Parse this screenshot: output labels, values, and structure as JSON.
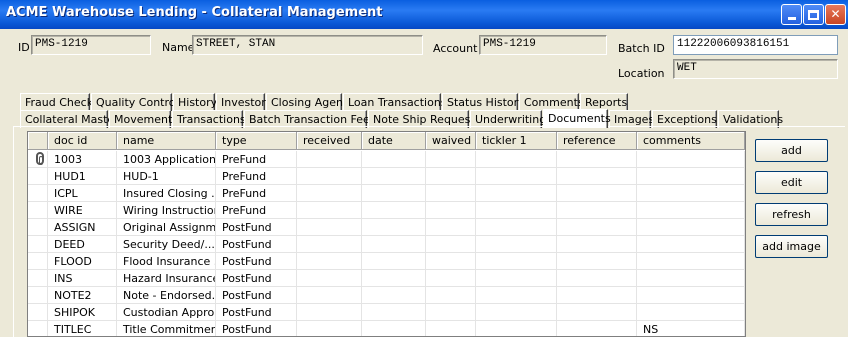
{
  "window": {
    "title": "ACME Warehouse Lending - Collateral Management"
  },
  "header": {
    "id_label": "ID",
    "id_value": "PMS-1219",
    "name_label": "Name",
    "name_value": "STREET, STAN",
    "account_label": "Account",
    "account_value": "PMS-1219",
    "batch_label": "Batch ID",
    "batch_value": "11222006093816151",
    "location_label": "Location",
    "location_value": "WET"
  },
  "tabs_row1": [
    "Fraud Check",
    "Quality Control",
    "History",
    "Investor",
    "Closing Agent",
    "Loan Transactions",
    "Status History",
    "Comments",
    "Reports"
  ],
  "tabs_row2": [
    "Collateral Master",
    "Movement",
    "Transactions",
    "Batch Transaction Fees",
    "Note Ship Request",
    "Underwriting",
    "Documents",
    "Images",
    "Exceptions",
    "Validations"
  ],
  "active_tab": "Documents",
  "grid": {
    "columns": [
      "doc id",
      "name",
      "type",
      "received",
      "date",
      "waived",
      "tickler 1",
      "reference",
      "comments"
    ],
    "rows": [
      {
        "doc_id": "1003",
        "name": "1003 Application",
        "type": "PreFund",
        "comments": "",
        "attached": true
      },
      {
        "doc_id": "HUD1",
        "name": "HUD-1",
        "type": "PreFund",
        "comments": ""
      },
      {
        "doc_id": "ICPL",
        "name": "Insured Closing ...",
        "type": "PreFund",
        "comments": ""
      },
      {
        "doc_id": "WIRE",
        "name": "Wiring Instructions",
        "type": "PreFund",
        "comments": ""
      },
      {
        "doc_id": "ASSIGN",
        "name": "Original Assignm...",
        "type": "PostFund",
        "comments": ""
      },
      {
        "doc_id": "DEED",
        "name": "Security Deed/...",
        "type": "PostFund",
        "comments": ""
      },
      {
        "doc_id": "FLOOD",
        "name": "Flood Insurance ...",
        "type": "PostFund",
        "comments": ""
      },
      {
        "doc_id": "INS",
        "name": "Hazard Insurance",
        "type": "PostFund",
        "comments": ""
      },
      {
        "doc_id": "NOTE2",
        "name": "Note - Endorsed...",
        "type": "PostFund",
        "comments": ""
      },
      {
        "doc_id": "SHIPOK",
        "name": "Custodian Appro...",
        "type": "PostFund",
        "comments": ""
      },
      {
        "doc_id": "TITLEC",
        "name": "Title Commitment",
        "type": "PostFund",
        "comments": "NS"
      }
    ]
  },
  "buttons": {
    "add": "add",
    "edit": "edit",
    "refresh": "refresh",
    "add_image": "add image"
  },
  "icons": {
    "attachment": "paperclip-icon",
    "minimize": "minimize-icon",
    "maximize": "maximize-icon",
    "close": "close-icon"
  }
}
